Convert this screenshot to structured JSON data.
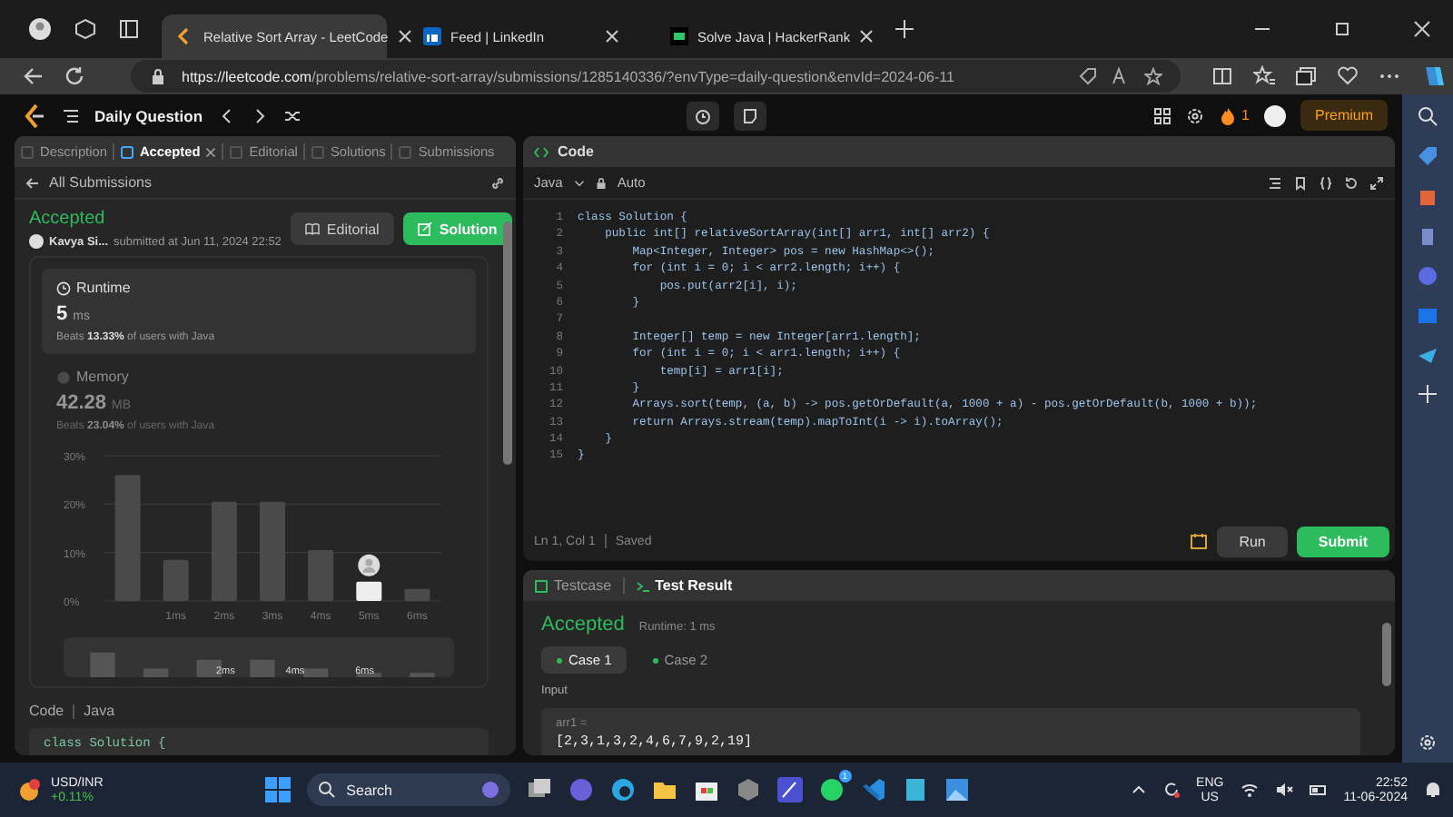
{
  "browser": {
    "tabs": [
      {
        "title": "Relative Sort Array - LeetCode",
        "selected": true
      },
      {
        "title": "Feed | LinkedIn",
        "selected": false
      },
      {
        "title": "Solve Java | HackerRank",
        "selected": false
      }
    ],
    "url_host": "https://leetcode.com",
    "url_path": "/problems/relative-sort-array/submissions/1285140336/?envType=daily-question&envId=2024-06-11"
  },
  "header": {
    "title": "Daily Question",
    "streak": "1",
    "premium": "Premium"
  },
  "left": {
    "tabs": [
      {
        "label": "Description",
        "selected": false,
        "closable": false
      },
      {
        "label": "Accepted",
        "selected": true,
        "closable": true
      },
      {
        "label": "Editorial",
        "selected": false,
        "closable": false
      },
      {
        "label": "Solutions",
        "selected": false,
        "closable": false
      },
      {
        "label": "Submissions",
        "selected": false,
        "closable": false
      }
    ],
    "back": "All Submissions",
    "status": "Accepted",
    "author": "Kavya Si...",
    "submitted": "submitted at Jun 11, 2024 22:52",
    "editorial_button": "Editorial",
    "solution_button": "Solution",
    "runtime": {
      "label": "Runtime",
      "value": "5",
      "unit": "ms",
      "beats": "Beats **13.33%** of users with Java"
    },
    "memory": {
      "label": "Memory",
      "value": "42.28",
      "unit": "MB",
      "beats": "Beats **23.04%** of users with Java"
    },
    "chart_data": {
      "type": "bar",
      "categories": [
        null,
        "1ms",
        "2ms",
        "3ms",
        "4ms",
        "5ms",
        "6ms"
      ],
      "stacked": true,
      "ylim": [
        0,
        30
      ],
      "yticks": [
        {
          "value": 0,
          "label": "0%"
        },
        {
          "value": 10,
          "label": "10%"
        },
        {
          "value": 20,
          "label": "20%"
        },
        {
          "value": 30,
          "label": "30%"
        }
      ],
      "series": [
        {
          "color": "#4a4a4a",
          "values": [
            26,
            8.5,
            20.5,
            20.5,
            10.5,
            null,
            2.5
          ]
        },
        {
          "color": "#eeeeee",
          "values": [
            null,
            null,
            null,
            null,
            null,
            4,
            null
          ]
        }
      ]
    },
    "overview_labels": [
      "2ms",
      "4ms",
      "6ms"
    ],
    "code_label": "Code",
    "code_lang": "Java",
    "code_preview": "class Solution {"
  },
  "editor": {
    "title": "Code",
    "language": "Java",
    "mode": "Auto",
    "lines": [
      {
        "n": "1",
        "code": "class Solution {"
      },
      {
        "n": "2",
        "code": "    public int[] relativeSortArray(int[] arr1, int[] arr2) {"
      },
      {
        "n": "3",
        "code": "        Map<Integer, Integer> pos = new HashMap<>();"
      },
      {
        "n": "4",
        "code": "        for (int i = 0; i < arr2.length; i++) {"
      },
      {
        "n": "5",
        "code": "            pos.put(arr2[i], i);"
      },
      {
        "n": "6",
        "code": "        }"
      },
      {
        "n": "7"
      },
      {
        "n": "8",
        "code": "        Integer[] temp = new Integer[arr1.length];"
      },
      {
        "n": "9",
        "code": "        for (int i = 0; i < arr1.length; i++) {"
      },
      {
        "n": "10",
        "code": "            temp[i] = arr1[i];"
      },
      {
        "n": "11",
        "code": "        }"
      },
      {
        "n": "12",
        "code": "        Arrays.sort(temp, (a, b) -> pos.getOrDefault(a, 1000 + a) - pos.getOrDefault(b, 1000 + b));"
      },
      {
        "n": "13",
        "code": "        return Arrays.stream(temp).mapToInt(i -> i).toArray();"
      },
      {
        "n": "14",
        "code": "    }"
      },
      {
        "n": "15",
        "code": "}"
      }
    ],
    "cursor": "Ln 1, Col 1",
    "saved": "Saved",
    "run": "Run",
    "submit": "Submit"
  },
  "result": {
    "tabs": [
      {
        "label": "Testcase",
        "selected": false
      },
      {
        "label": "Test Result",
        "selected": true
      }
    ],
    "status": "Accepted",
    "runtime": "Runtime: 1 ms",
    "cases": [
      {
        "label": "Case 1",
        "selected": true
      },
      {
        "label": "Case 2",
        "selected": false
      }
    ],
    "input_label": "Input",
    "var": "arr1 =",
    "value": "[2,3,1,3,2,4,6,7,9,2,19]"
  },
  "taskbar": {
    "ticker": "USD/INR",
    "change": "+0.11%",
    "search": "Search",
    "whatsapp_badge": "1",
    "lang": "ENG",
    "region": "US",
    "time": "22:52",
    "date": "11-06-2024"
  }
}
